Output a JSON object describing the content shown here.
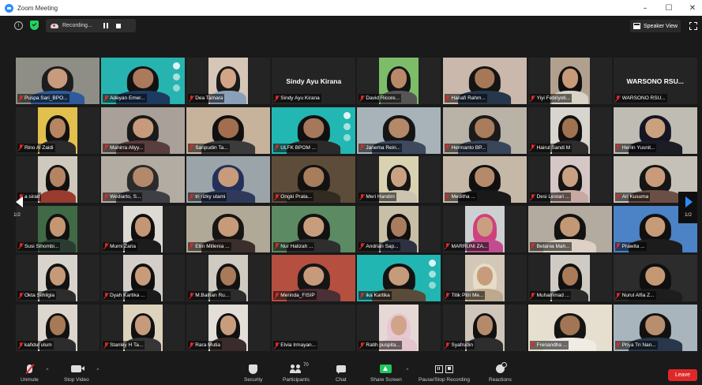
{
  "window": {
    "title": "Zoom Meeting",
    "controls": [
      "–",
      "☐",
      "✕"
    ]
  },
  "topbar": {
    "info_icon": "i",
    "recording_label": "Recording...",
    "speaker_view_label": "Speaker View"
  },
  "gallery": {
    "page_indicator_left": "1/2",
    "page_indicator_right": "1/2",
    "participants": [
      {
        "name": "Puspa Sari_BPO...",
        "bg": "#8f8e86",
        "skin": "#c79b7c",
        "shirt": "#2f5b9a",
        "hair": "#1d1d1d",
        "cam": true,
        "active": true
      },
      {
        "name": "Adeyan Emer...",
        "bg": "#27b4b0",
        "skin": "#a97a5c",
        "shirt": "#1d3a60",
        "hair": "#111",
        "cam": true,
        "logo": true
      },
      {
        "name": "Dea Tamara",
        "bg": "#d6c6b8",
        "skin": "#d1a585",
        "shirt": "#8aa0b8",
        "hair": "#1a1a1a",
        "cam": true,
        "narrow": true
      },
      {
        "name": "Sindy Ayu Kirana",
        "cam": false,
        "headline": "Sindy Ayu Kirana"
      },
      {
        "name": "David Ricore...",
        "bg": "#7dbd6a",
        "skin": "#b98a6a",
        "shirt": "#555",
        "hair": "#151515",
        "cam": true,
        "narrow": true
      },
      {
        "name": "Hanafi Rahm...",
        "bg": "#c9b8ab",
        "skin": "#a77857",
        "shirt": "#26374b",
        "hair": "#141414",
        "cam": true
      },
      {
        "name": "Yiyi Febriyoti...",
        "bg": "#b2a08f",
        "skin": "#c89a78",
        "shirt": "#d9d2c6",
        "hair": "#111",
        "cam": true,
        "narrow": true
      },
      {
        "name": "WARSONO  RSU...",
        "cam": false,
        "headline": "WARSONO  RSU..."
      },
      {
        "name": "Rino Al Zaidi",
        "bg": "#e2c04d",
        "skin": "#b78560",
        "shirt": "#2b2b2b",
        "hair": "#121212",
        "cam": true,
        "narrow": true
      },
      {
        "name": "Mahirra Allyy...",
        "bg": "#a9a09a",
        "skin": "#c69a7a",
        "shirt": "#5a3d3d",
        "hair": "#1a1a1a",
        "cam": true
      },
      {
        "name": "Saripudin Ta...",
        "bg": "#c7b39c",
        "skin": "#a26e4f",
        "shirt": "#3b3b3b",
        "hair": "#101010",
        "cam": true
      },
      {
        "name": "ULFK BPOM ...",
        "bg": "#22b7b2",
        "skin": "#a5785b",
        "shirt": "#2a2a2a",
        "hair": "#101010",
        "cam": true,
        "logo": true
      },
      {
        "name": "Janema Rein...",
        "bg": "#a7b3b9",
        "skin": "#b48868",
        "shirt": "#3d4a5d",
        "hair": "#151515",
        "cam": true
      },
      {
        "name": "Hermanto BP...",
        "bg": "#b9b2a6",
        "skin": "#a97c5c",
        "shirt": "#39465a",
        "hair": "#1a1a1a",
        "cam": true
      },
      {
        "name": "Hairul Sandi M",
        "bg": "#d8d4ce",
        "skin": "#a1724f",
        "shirt": "#2d2d2d",
        "hair": "#111",
        "cam": true,
        "narrow": true
      },
      {
        "name": "Herlin Yusnit...",
        "bg": "#bfbcb3",
        "skin": "#caa07f",
        "shirt": "#1c1c24",
        "hair": "#151524",
        "cam": true
      },
      {
        "name": "a sirait",
        "bg": "#cfc8bd",
        "skin": "#b58463",
        "shirt": "#993b2e",
        "hair": "#111",
        "cam": true,
        "narrow": true
      },
      {
        "name": "Wediarto, S...",
        "bg": "#b3aca3",
        "skin": "#b4886b",
        "shirt": "#3e3f44",
        "hair": "#2b2b2b",
        "cam": true
      },
      {
        "name": "tri rizky utami",
        "bg": "#9aa4a9",
        "skin": "#c79c7b",
        "shirt": "#2f3a5b",
        "hair": "#25305a",
        "cam": true
      },
      {
        "name": "Ongki Prata...",
        "bg": "#5e4c3a",
        "skin": "#a77d5c",
        "shirt": "#322b22",
        "hair": "#121212",
        "cam": true
      },
      {
        "name": "Meri Handini",
        "bg": "#d9d2b0",
        "skin": "#caa282",
        "shirt": "#ccc4b1",
        "hair": "#171717",
        "cam": true,
        "narrow": true
      },
      {
        "name": "Meditha ...",
        "bg": "#c6b8a7",
        "skin": "#b58a6a",
        "shirt": "#191919",
        "hair": "#101010",
        "cam": true
      },
      {
        "name": "Desi Lestari ...",
        "bg": "#d5c7c6",
        "skin": "#c9a081",
        "shirt": "#c8a8a2",
        "hair": "#141414",
        "cam": true,
        "narrow": true
      },
      {
        "name": "Ari Kusuma",
        "bg": "#c6c1b8",
        "skin": "#c99b7b",
        "shirt": "#6b4f44",
        "hair": "#151515",
        "cam": true
      },
      {
        "name": "Susi Sihombi...",
        "bg": "#3f6a45",
        "skin": "#c49672",
        "shirt": "#2c3b32",
        "hair": "#111",
        "cam": true,
        "narrow": true
      },
      {
        "name": "Murni Zaria",
        "bg": "#ddd9d3",
        "skin": "#c39774",
        "shirt": "#1c1c1c",
        "hair": "#0f0f0f",
        "cam": true,
        "narrow": true
      },
      {
        "name": "Ellin Millenia ...",
        "bg": "#b1a998",
        "skin": "#c79b7a",
        "shirt": "#3b2f2b",
        "hair": "#151515",
        "cam": true
      },
      {
        "name": "Nur Halizah ...",
        "bg": "#5b8a63",
        "skin": "#c89d7d",
        "shirt": "#2e2e2e",
        "hair": "#121212",
        "cam": true
      },
      {
        "name": "Andrian Sap...",
        "bg": "#c7bfa6",
        "skin": "#a97c5d",
        "shirt": "#2d3140",
        "hair": "#101010",
        "cam": true,
        "narrow": true
      },
      {
        "name": "MARRUNI ZA...",
        "bg": "#cdd0d0",
        "skin": "#c99f7f",
        "shirt": "#c24c8d",
        "hair": "#d0407f",
        "cam": true,
        "narrow": true
      },
      {
        "name": "Betania Mah...",
        "bg": "#b3aaa0",
        "skin": "#c39876",
        "shirt": "#ddd0c5",
        "hair": "#121212",
        "cam": true
      },
      {
        "name": "Prawita ...",
        "bg": "#4c82c6",
        "skin": "#c79b78",
        "shirt": "#1c1c1c",
        "hair": "#101010",
        "cam": true
      },
      {
        "name": "Okta Silhilgia",
        "bg": "#d8d3cc",
        "skin": "#c49a78",
        "shirt": "#2c2c2c",
        "hair": "#121212",
        "cam": true,
        "narrow": true
      },
      {
        "name": "Dyah Kartika ...",
        "bg": "#d3cfc8",
        "skin": "#c89c7b",
        "shirt": "#1a1a1a",
        "hair": "#0f0f0f",
        "cam": true,
        "narrow": true
      },
      {
        "name": "M.Baihan Ru...",
        "bg": "#cfcac2",
        "skin": "#a87a59",
        "shirt": "#2c2c2c",
        "hair": "#121212",
        "cam": true,
        "narrow": true
      },
      {
        "name": "Merinda_FISIP",
        "bg": "#b54f3f",
        "skin": "#c79b7a",
        "shirt": "#4a2f34",
        "hair": "#151515",
        "cam": true
      },
      {
        "name": "ika Kartika",
        "bg": "#21b6b1",
        "skin": "#c59b7b",
        "shirt": "#5a4a3a",
        "hair": "#121212",
        "cam": true,
        "logo": true
      },
      {
        "name": "Titik Pitri Me...",
        "bg": "#d3c8b8",
        "skin": "#c69c7b",
        "shirt": "#bda98d",
        "hair": "#e6ddc8",
        "cam": true,
        "narrow": true
      },
      {
        "name": "Muhammad ...",
        "bg": "#cfcac4",
        "skin": "#a97b59",
        "shirt": "#2b2b2b",
        "hair": "#101010",
        "cam": true,
        "narrow": true
      },
      {
        "name": "Nurul Alfia Z...",
        "bg": "#2c2c2c",
        "skin": "#c49873",
        "shirt": "#1d1d1d",
        "hair": "#0f0f0f",
        "cam": true
      },
      {
        "name": "kafidul ulum",
        "bg": "#ddd6cf",
        "skin": "#a77a57",
        "shirt": "#2c2c2c",
        "hair": "#111",
        "cam": true,
        "narrow": true
      },
      {
        "name": "Stanley H Ta...",
        "bg": "#ddd3bd",
        "skin": "#c59b7b",
        "shirt": "#363636",
        "hair": "#111",
        "cam": true,
        "narrow": true
      },
      {
        "name": "Rara Mutia",
        "bg": "#e3dfd8",
        "skin": "#c89d7d",
        "shirt": "#3a2c2c",
        "hair": "#111",
        "cam": true,
        "narrow": true
      },
      {
        "name": "Elvia Irmayan...",
        "cam": false,
        "headline": ""
      },
      {
        "name": "Ratih puspita...",
        "bg": "#e6d9d5",
        "skin": "#cfa489",
        "shirt": "#e2c5cd",
        "hair": "#e7c7d3",
        "cam": true,
        "narrow": true
      },
      {
        "name": "Syafrudin",
        "bg": "#cfc5ba",
        "skin": "#b48b6a",
        "shirt": "#2d2d2d",
        "hair": "#111",
        "cam": true,
        "narrow": true
      },
      {
        "name": "Frenandha ...",
        "bg": "#e6dfcf",
        "skin": "#a27554",
        "shirt": "#f0ece4",
        "hair": "#141414",
        "cam": true
      },
      {
        "name": "Priya Tri Nan...",
        "bg": "#a9b5bd",
        "skin": "#b98e6c",
        "shirt": "#28384a",
        "hair": "#111",
        "cam": true
      }
    ]
  },
  "toolbar": {
    "unmute_label": "Unmute",
    "stop_video_label": "Stop Video",
    "security_label": "Security",
    "participants_label": "Participants",
    "participants_count": "70",
    "chat_label": "Chat",
    "share_screen_label": "Share Screen",
    "recording_label": "Pause/Stop Recording",
    "reactions_label": "Reactions",
    "leave_label": "Leave"
  },
  "colors": {
    "accent": "#2d8cff",
    "active_speaker": "#e5dc4b",
    "leave": "#e02828",
    "share": "#23c55e"
  }
}
